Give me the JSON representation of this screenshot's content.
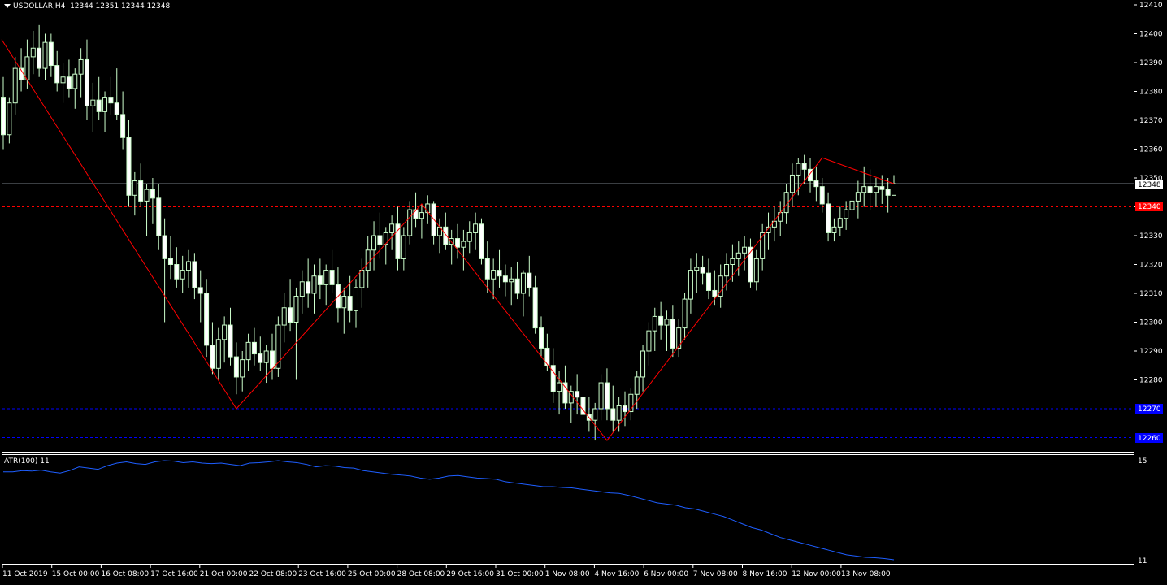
{
  "header": {
    "symbol_timeframe": "USDOLLAR,H4",
    "ohlc": "12344 12351 12344 12348"
  },
  "indicator": {
    "label": "ATR(100) 11",
    "axis_top": "15",
    "axis_bottom": "11"
  },
  "colors": {
    "background": "#000000",
    "frame": "#ffffff",
    "bull_candle": "#ccffcc",
    "bear_candle": "#ffffff",
    "wick": "#ccffcc",
    "zigzag": "#ff0000",
    "price_line": "#9aa6b2",
    "red_level": "#ff0000",
    "blue_level": "#0000ff",
    "atr_line": "#1e5eff"
  },
  "price_axis": {
    "ticks": [
      "12410",
      "12400",
      "12390",
      "12380",
      "12370",
      "12360",
      "12350",
      "12340",
      "12330",
      "12320",
      "12310",
      "12300",
      "12290",
      "12280"
    ],
    "current_price_label": "12348",
    "red_level_label": "12340",
    "blue_level_1_label": "12270",
    "blue_level_2_label": "12260"
  },
  "time_axis": {
    "labels": [
      "11 Oct 2019",
      "15 Oct 00:00",
      "16 Oct 08:00",
      "17 Oct 16:00",
      "21 Oct 00:00",
      "22 Oct 08:00",
      "23 Oct 16:00",
      "25 Oct 00:00",
      "28 Oct 08:00",
      "29 Oct 16:00",
      "31 Oct 00:00",
      "1 Nov 08:00",
      "4 Nov 16:00",
      "6 Nov 00:00",
      "7 Nov 08:00",
      "8 Nov 16:00",
      "12 Nov 00:00",
      "13 Nov 08:00"
    ]
  },
  "chart_data": {
    "type": "candlestick",
    "symbol": "USDOLLAR",
    "timeframe": "H4",
    "ylim": [
      12257,
      12411
    ],
    "current_price": 12348,
    "levels": {
      "red_dashed": 12340,
      "blue_dashed": [
        12270,
        12260
      ]
    },
    "zigzag": [
      12398,
      12270,
      12341,
      12259,
      12357,
      12348
    ],
    "candles": [
      [
        12378,
        12385,
        12360,
        12365
      ],
      [
        12365,
        12378,
        12362,
        12376
      ],
      [
        12376,
        12392,
        12372,
        12388
      ],
      [
        12388,
        12395,
        12380,
        12384
      ],
      [
        12384,
        12398,
        12381,
        12392
      ],
      [
        12392,
        12401,
        12386,
        12395
      ],
      [
        12395,
        12403,
        12385,
        12388
      ],
      [
        12388,
        12400,
        12384,
        12397
      ],
      [
        12397,
        12400,
        12385,
        12389
      ],
      [
        12389,
        12394,
        12380,
        12383
      ],
      [
        12383,
        12390,
        12376,
        12385
      ],
      [
        12385,
        12391,
        12378,
        12381
      ],
      [
        12381,
        12388,
        12374,
        12386
      ],
      [
        12386,
        12395,
        12378,
        12391
      ],
      [
        12391,
        12398,
        12370,
        12375
      ],
      [
        12375,
        12383,
        12366,
        12377
      ],
      [
        12377,
        12385,
        12370,
        12373
      ],
      [
        12373,
        12380,
        12366,
        12378
      ],
      [
        12378,
        12385,
        12372,
        12376
      ],
      [
        12376,
        12388,
        12370,
        12372
      ],
      [
        12372,
        12380,
        12360,
        12364
      ],
      [
        12364,
        12370,
        12340,
        12344
      ],
      [
        12344,
        12352,
        12337,
        12349
      ],
      [
        12349,
        12355,
        12340,
        12342
      ],
      [
        12342,
        12348,
        12330,
        12346
      ],
      [
        12346,
        12350,
        12334,
        12343
      ],
      [
        12343,
        12348,
        12325,
        12330
      ],
      [
        12330,
        12336,
        12300,
        12322
      ],
      [
        12322,
        12330,
        12315,
        12320
      ],
      [
        12320,
        12326,
        12312,
        12315
      ],
      [
        12315,
        12323,
        12310,
        12318
      ],
      [
        12318,
        12325,
        12312,
        12321
      ],
      [
        12321,
        12324,
        12308,
        12312
      ],
      [
        12312,
        12318,
        12300,
        12310
      ],
      [
        12310,
        12315,
        12288,
        12292
      ],
      [
        12292,
        12300,
        12282,
        12284
      ],
      [
        12284,
        12298,
        12280,
        12294
      ],
      [
        12294,
        12302,
        12286,
        12299
      ],
      [
        12299,
        12305,
        12285,
        12288
      ],
      [
        12288,
        12293,
        12275,
        12281
      ],
      [
        12281,
        12290,
        12276,
        12287
      ],
      [
        12287,
        12296,
        12283,
        12293
      ],
      [
        12293,
        12298,
        12285,
        12289
      ],
      [
        12289,
        12295,
        12283,
        12286
      ],
      [
        12286,
        12292,
        12279,
        12290
      ],
      [
        12290,
        12296,
        12280,
        12284
      ],
      [
        12284,
        12302,
        12281,
        12299
      ],
      [
        12299,
        12310,
        12293,
        12305
      ],
      [
        12305,
        12315,
        12297,
        12300
      ],
      [
        12300,
        12312,
        12280,
        12309
      ],
      [
        12309,
        12318,
        12303,
        12314
      ],
      [
        12314,
        12322,
        12305,
        12310
      ],
      [
        12310,
        12320,
        12303,
        12316
      ],
      [
        12316,
        12322,
        12308,
        12313
      ],
      [
        12313,
        12320,
        12306,
        12318
      ],
      [
        12318,
        12325,
        12310,
        12313
      ],
      [
        12313,
        12319,
        12300,
        12305
      ],
      [
        12305,
        12312,
        12296,
        12309
      ],
      [
        12309,
        12316,
        12300,
        12304
      ],
      [
        12304,
        12315,
        12298,
        12312
      ],
      [
        12312,
        12322,
        12305,
        12318
      ],
      [
        12318,
        12330,
        12312,
        12325
      ],
      [
        12325,
        12335,
        12318,
        12330
      ],
      [
        12330,
        12338,
        12322,
        12327
      ],
      [
        12327,
        12333,
        12320,
        12331
      ],
      [
        12331,
        12337,
        12325,
        12334
      ],
      [
        12334,
        12340,
        12318,
        12322
      ],
      [
        12322,
        12333,
        12318,
        12330
      ],
      [
        12330,
        12342,
        12327,
        12339
      ],
      [
        12339,
        12345,
        12333,
        12336
      ],
      [
        12336,
        12341,
        12329,
        12338
      ],
      [
        12338,
        12344,
        12334,
        12341
      ],
      [
        12341,
        12342,
        12327,
        12330
      ],
      [
        12330,
        12336,
        12324,
        12333
      ],
      [
        12333,
        12338,
        12325,
        12327
      ],
      [
        12327,
        12332,
        12320,
        12329
      ],
      [
        12329,
        12334,
        12322,
        12326
      ],
      [
        12326,
        12332,
        12318,
        12328
      ],
      [
        12328,
        12335,
        12324,
        12331
      ],
      [
        12331,
        12338,
        12325,
        12334
      ],
      [
        12334,
        12336,
        12320,
        12322
      ],
      [
        12322,
        12328,
        12310,
        12315
      ],
      [
        12315,
        12322,
        12308,
        12318
      ],
      [
        12318,
        12325,
        12312,
        12316
      ],
      [
        12316,
        12320,
        12309,
        12314
      ],
      [
        12314,
        12319,
        12306,
        12315
      ],
      [
        12315,
        12321,
        12308,
        12310
      ],
      [
        12310,
        12318,
        12302,
        12317
      ],
      [
        12317,
        12323,
        12309,
        12312
      ],
      [
        12312,
        12316,
        12296,
        12298
      ],
      [
        12298,
        12302,
        12288,
        12291
      ],
      [
        12291,
        12296,
        12283,
        12285
      ],
      [
        12285,
        12291,
        12272,
        12276
      ],
      [
        12276,
        12283,
        12268,
        12279
      ],
      [
        12279,
        12285,
        12270,
        12272
      ],
      [
        12272,
        12278,
        12265,
        12276
      ],
      [
        12276,
        12282,
        12268,
        12274
      ],
      [
        12274,
        12279,
        12265,
        12268
      ],
      [
        12268,
        12274,
        12262,
        12266
      ],
      [
        12266,
        12272,
        12259,
        12270
      ],
      [
        12270,
        12282,
        12266,
        12279
      ],
      [
        12279,
        12284,
        12266,
        12270
      ],
      [
        12270,
        12278,
        12262,
        12266
      ],
      [
        12266,
        12274,
        12262,
        12271
      ],
      [
        12271,
        12276,
        12264,
        12269
      ],
      [
        12269,
        12277,
        12266,
        12275
      ],
      [
        12275,
        12283,
        12270,
        12281
      ],
      [
        12281,
        12292,
        12276,
        12290
      ],
      [
        12290,
        12300,
        12285,
        12297
      ],
      [
        12297,
        12305,
        12290,
        12302
      ],
      [
        12302,
        12307,
        12294,
        12299
      ],
      [
        12299,
        12304,
        12290,
        12301
      ],
      [
        12301,
        12306,
        12288,
        12291
      ],
      [
        12291,
        12301,
        12288,
        12298
      ],
      [
        12298,
        12310,
        12294,
        12308
      ],
      [
        12308,
        12322,
        12303,
        12318
      ],
      [
        12318,
        12324,
        12310,
        12319
      ],
      [
        12319,
        12323,
        12313,
        12317
      ],
      [
        12317,
        12322,
        12308,
        12311
      ],
      [
        12311,
        12318,
        12306,
        12309
      ],
      [
        12309,
        12320,
        12305,
        12316
      ],
      [
        12316,
        12324,
        12311,
        12320
      ],
      [
        12320,
        12327,
        12314,
        12322
      ],
      [
        12322,
        12328,
        12316,
        12324
      ],
      [
        12324,
        12330,
        12318,
        12326
      ],
      [
        12326,
        12329,
        12312,
        12314
      ],
      [
        12314,
        12325,
        12311,
        12322
      ],
      [
        12322,
        12334,
        12318,
        12331
      ],
      [
        12331,
        12338,
        12325,
        12333
      ],
      [
        12333,
        12340,
        12328,
        12335
      ],
      [
        12335,
        12342,
        12330,
        12338
      ],
      [
        12338,
        12348,
        12334,
        12345
      ],
      [
        12345,
        12355,
        12340,
        12351
      ],
      [
        12351,
        12357,
        12344,
        12355
      ],
      [
        12355,
        12358,
        12348,
        12353
      ],
      [
        12353,
        12357,
        12345,
        12349
      ],
      [
        12349,
        12354,
        12342,
        12347
      ],
      [
        12347,
        12350,
        12338,
        12341
      ],
      [
        12341,
        12345,
        12328,
        12331
      ],
      [
        12331,
        12336,
        12328,
        12333
      ],
      [
        12333,
        12340,
        12330,
        12336
      ],
      [
        12336,
        12342,
        12332,
        12339
      ],
      [
        12339,
        12346,
        12335,
        12342
      ],
      [
        12342,
        12349,
        12336,
        12345
      ],
      [
        12345,
        12354,
        12340,
        12347
      ],
      [
        12347,
        12353,
        12339,
        12345
      ],
      [
        12345,
        12350,
        12340,
        12347
      ],
      [
        12347,
        12351,
        12341,
        12346
      ],
      [
        12346,
        12350,
        12338,
        12344
      ],
      [
        12344,
        12351,
        12344,
        12348
      ]
    ],
    "atr": [
      14.55,
      14.55,
      14.6,
      14.58,
      14.62,
      14.55,
      14.5,
      14.6,
      14.75,
      14.7,
      14.65,
      14.8,
      14.9,
      14.95,
      14.88,
      14.85,
      14.95,
      15.0,
      14.98,
      14.92,
      14.95,
      14.9,
      14.88,
      14.9,
      14.85,
      14.8,
      14.9,
      14.92,
      14.95,
      15.0,
      14.95,
      14.92,
      14.85,
      14.75,
      14.8,
      14.78,
      14.72,
      14.7,
      14.6,
      14.55,
      14.5,
      14.45,
      14.42,
      14.38,
      14.3,
      14.25,
      14.3,
      14.38,
      14.4,
      14.35,
      14.3,
      14.28,
      14.25,
      14.15,
      14.1,
      14.05,
      14.0,
      13.95,
      13.95,
      13.92,
      13.9,
      13.85,
      13.8,
      13.75,
      13.7,
      13.68,
      13.6,
      13.5,
      13.4,
      13.3,
      13.25,
      13.2,
      13.1,
      13.05,
      12.95,
      12.85,
      12.75,
      12.6,
      12.45,
      12.3,
      12.2,
      12.05,
      11.9,
      11.8,
      11.7,
      11.6,
      11.5,
      11.4,
      11.3,
      11.2,
      11.15,
      11.1,
      11.08,
      11.05,
      11.0
    ]
  }
}
